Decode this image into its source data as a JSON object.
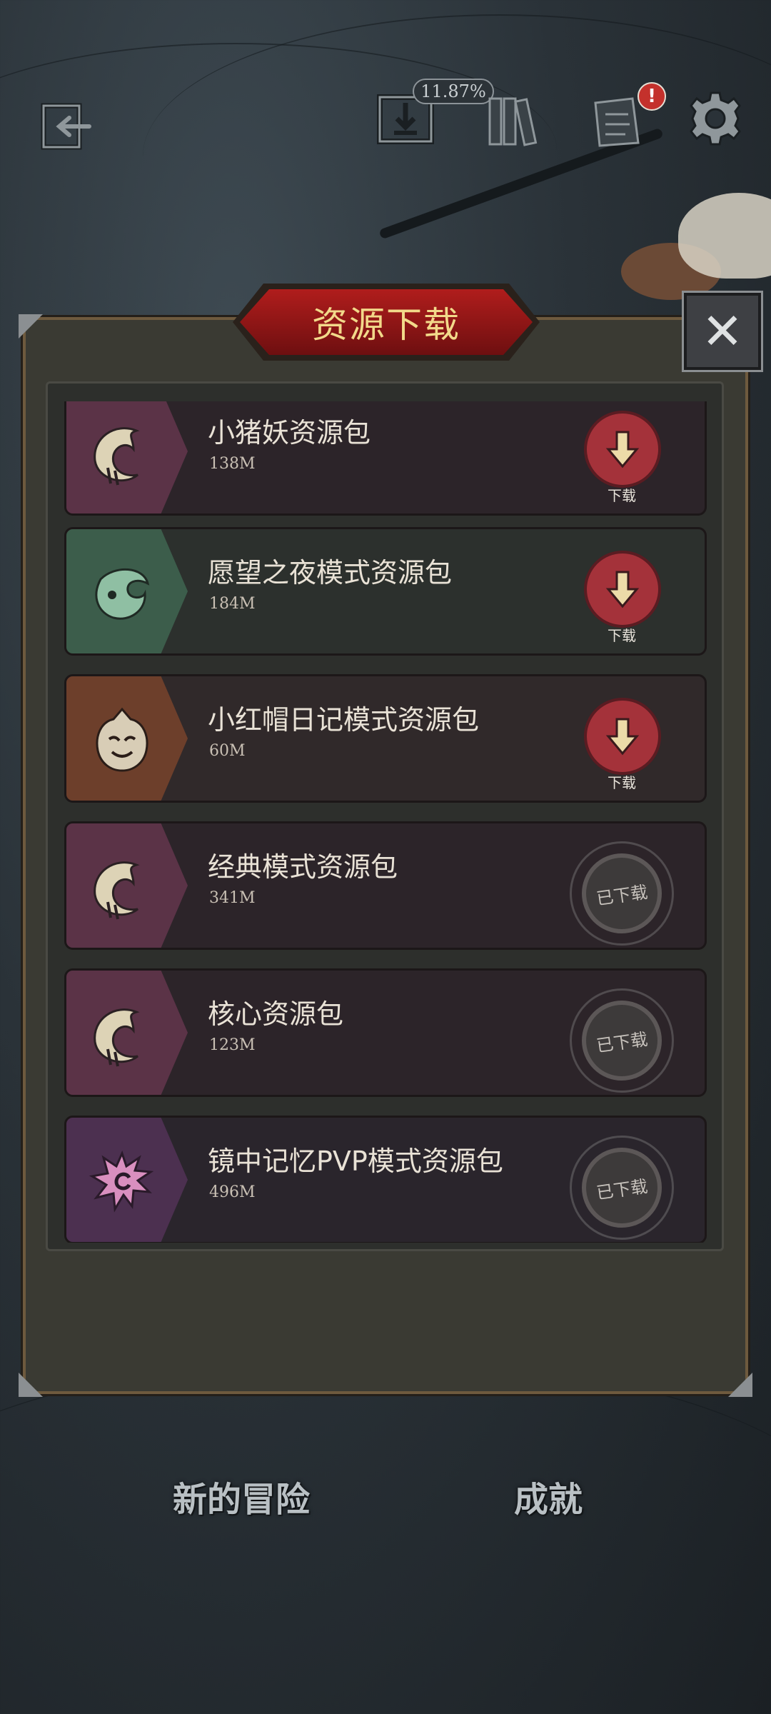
{
  "topbar": {
    "download_progress": "11.87%",
    "notes_badge": "!"
  },
  "dialog": {
    "title": "资源下载",
    "close_label": "✕"
  },
  "packs": [
    {
      "name": "小猪妖资源包",
      "size": "138M",
      "status": "download",
      "action_label": "下载",
      "accent": "#5b3347",
      "emblem": "moon-spiral-icon"
    },
    {
      "name": "愿望之夜模式资源包",
      "size": "184M",
      "status": "download",
      "action_label": "下载",
      "accent": "#3c5d4b",
      "emblem": "leaf-spiral-icon"
    },
    {
      "name": "小红帽日记模式资源包",
      "size": "60M",
      "status": "download",
      "action_label": "下载",
      "accent": "#6d3f2b",
      "emblem": "hooded-mask-icon"
    },
    {
      "name": "经典模式资源包",
      "size": "341M",
      "status": "downloaded",
      "action_label": "已下载",
      "accent": "#5b3347",
      "emblem": "moon-spiral-icon"
    },
    {
      "name": "核心资源包",
      "size": "123M",
      "status": "downloaded",
      "action_label": "已下载",
      "accent": "#5b3347",
      "emblem": "moon-spiral-icon"
    },
    {
      "name": "镜中记忆PVP模式资源包",
      "size": "496M",
      "status": "downloaded",
      "action_label": "已下载",
      "accent": "#4c3050",
      "emblem": "spiky-spiral-icon"
    }
  ],
  "bottom_menu": {
    "new_adventure": "新的冒险",
    "achievements": "成就"
  },
  "colors": {
    "download_button": "#a4323a",
    "title_text": "#f2d98a"
  }
}
